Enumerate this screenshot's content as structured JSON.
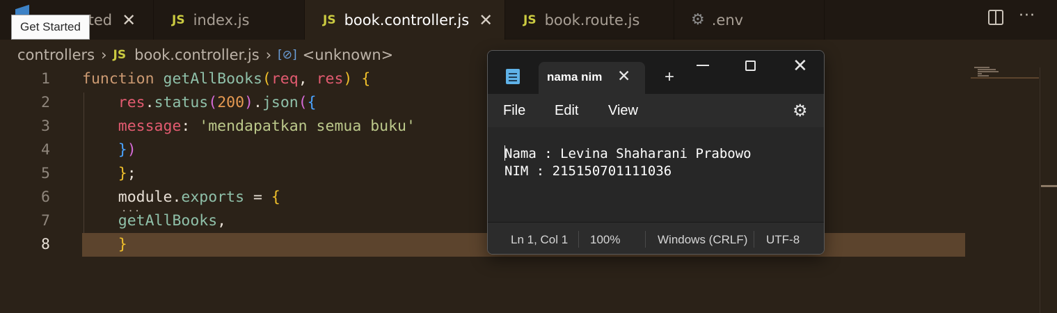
{
  "tabs": [
    {
      "label": "Get Started",
      "partial": "rted",
      "active": false
    },
    {
      "label": "index.js",
      "icon": "js-icon",
      "active": false
    },
    {
      "label": "book.controller.js",
      "icon": "js-icon",
      "active": true
    },
    {
      "label": "book.route.js",
      "icon": "js-icon",
      "active": false
    },
    {
      "label": ".env",
      "icon": "gear-icon",
      "active": false
    }
  ],
  "tab_icon_text": "JS",
  "tooltip": "Get Started",
  "breadcrumb": {
    "folder": "controllers",
    "file": "book.controller.js",
    "symbol": "<unknown>"
  },
  "editor": {
    "line_numbers": [
      "1",
      "2",
      "3",
      "4",
      "5",
      "6",
      "7",
      "8"
    ],
    "current_line": 8,
    "lines": [
      [
        {
          "t": "function ",
          "c": "kw"
        },
        {
          "t": "getAllBooks",
          "c": "fn"
        },
        {
          "t": "(",
          "c": "br1"
        },
        {
          "t": "req",
          "c": "pr"
        },
        {
          "t": ", ",
          "c": "pl"
        },
        {
          "t": "res",
          "c": "pr"
        },
        {
          "t": ") ",
          "c": "br1"
        },
        {
          "t": "{",
          "c": "br1"
        }
      ],
      [
        {
          "t": "    res",
          "c": "pr"
        },
        {
          "t": ".",
          "c": "pl"
        },
        {
          "t": "status",
          "c": "fn"
        },
        {
          "t": "(",
          "c": "br2"
        },
        {
          "t": "200",
          "c": "num"
        },
        {
          "t": ")",
          "c": "br2"
        },
        {
          "t": ".",
          "c": "pl"
        },
        {
          "t": "json",
          "c": "fn"
        },
        {
          "t": "(",
          "c": "br2"
        },
        {
          "t": "{",
          "c": "br3"
        }
      ],
      [
        {
          "t": "    message",
          "c": "pr"
        },
        {
          "t": ": ",
          "c": "pl"
        },
        {
          "t": "'mendapatkan semua buku'",
          "c": "str"
        }
      ],
      [
        {
          "t": "    }",
          "c": "br3"
        },
        {
          "t": ")",
          "c": "br2"
        }
      ],
      [
        {
          "t": "    }",
          "c": "br1"
        },
        {
          "t": ";",
          "c": "pl"
        }
      ],
      [
        {
          "t": "    module",
          "c": "pl"
        },
        {
          "t": ".",
          "c": "pl"
        },
        {
          "t": "exports",
          "c": "fn"
        },
        {
          "t": " = ",
          "c": "pl"
        },
        {
          "t": "{",
          "c": "br1"
        }
      ],
      [
        {
          "t": "    getAllBooks",
          "c": "fn"
        },
        {
          "t": ",",
          "c": "pl"
        }
      ],
      [
        {
          "t": "    }",
          "c": "br1"
        }
      ]
    ]
  },
  "notepad": {
    "tab_title": "nama nim",
    "menu": [
      "File",
      "Edit",
      "View"
    ],
    "content_lines": [
      "Nama : Levina Shaharani Prabowo",
      "NIM : 215150701111036"
    ],
    "status": {
      "position": "Ln 1, Col 1",
      "zoom": "100%",
      "line_ending": "Windows (CRLF)",
      "encoding": "UTF-8"
    }
  },
  "colors": {
    "editor_bg": "#2b2218",
    "current_line": "#5c442d",
    "js_icon": "#cbcb41",
    "notepad_bg": "#202020"
  }
}
